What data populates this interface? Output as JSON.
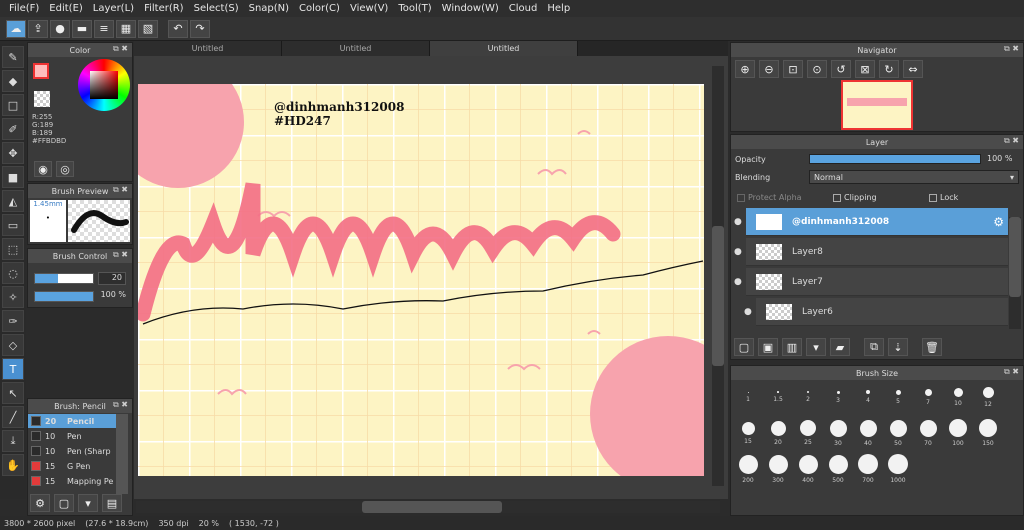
{
  "menu": [
    "File(F)",
    "Edit(E)",
    "Layer(L)",
    "Filter(R)",
    "Select(S)",
    "Snap(N)",
    "Color(C)",
    "View(V)",
    "Tool(T)",
    "Window(W)",
    "Cloud",
    "Help"
  ],
  "tabs": [
    "Untitled",
    "Untitled",
    "Untitled"
  ],
  "color_panel": {
    "title": "Color",
    "r": "R:255",
    "g": "G:189",
    "b": "B:189",
    "hex": "#FFBDBD",
    "fg_color": "#FFBDBD"
  },
  "brush_preview": {
    "title": "Brush Preview",
    "size": "1.45mm"
  },
  "brush_control": {
    "title": "Brush Control",
    "size_value": "20",
    "opacity_value": "100 %"
  },
  "brush_list": {
    "title": "Brush: Pencil",
    "items": [
      {
        "size": "20",
        "name": "Pencil",
        "color": "#2b2b2b"
      },
      {
        "size": "10",
        "name": "Pen",
        "color": "#2b2b2b"
      },
      {
        "size": "10",
        "name": "Pen (Sharp",
        "color": "#2b2b2b"
      },
      {
        "size": "15",
        "name": "G Pen",
        "color": "#e23b3b"
      },
      {
        "size": "15",
        "name": "Mapping Pe",
        "color": "#e23b3b"
      }
    ]
  },
  "artwork": {
    "handle": "@dinhmanh312008",
    "tag": "#HD247",
    "bg_color": "#fdf4c4",
    "accent": "#f7a3ad"
  },
  "navigator": {
    "title": "Navigator"
  },
  "layer_panel": {
    "title": "Layer",
    "opacity_label": "Opacity",
    "opacity_value": "100 %",
    "blending_label": "Blending",
    "blending_value": "Normal",
    "protect_alpha": "Protect Alpha",
    "clipping": "Clipping",
    "lock": "Lock",
    "layers": [
      "@dinhmanh312008",
      "Layer8",
      "Layer7",
      "Layer6"
    ]
  },
  "brush_size": {
    "title": "Brush Size",
    "sizes": [
      "1",
      "1.5",
      "2",
      "3",
      "4",
      "5",
      "7",
      "10",
      "12",
      "15",
      "20",
      "25",
      "30",
      "40",
      "50",
      "70",
      "100",
      "150",
      "200",
      "300",
      "400",
      "500",
      "700",
      "1000"
    ]
  },
  "status": {
    "size": "3800 * 2600 pixel",
    "cm": "(27.6 * 18.9cm)",
    "dpi": "350 dpi",
    "zoom": "20 %",
    "coords": "( 1530, -72 )"
  }
}
